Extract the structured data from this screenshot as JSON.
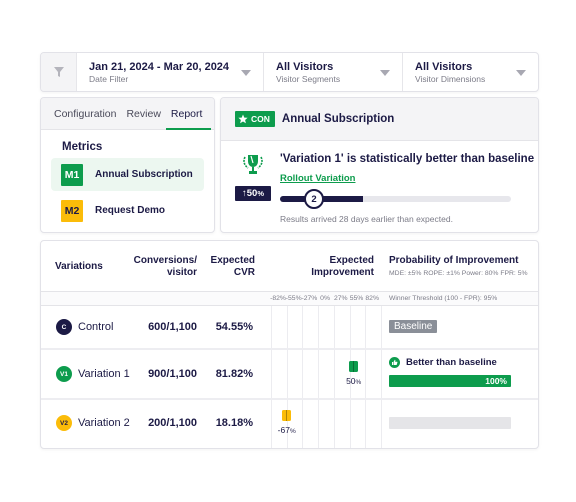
{
  "filter_bar": {
    "icon": "filter-icon",
    "segments": [
      {
        "value": "Jan 21, 2024 - Mar 20, 2024",
        "label": "Date Filter"
      },
      {
        "value": "All Visitors",
        "label": "Visitor Segments"
      },
      {
        "value": "All Visitors",
        "label": "Visitor Dimensions"
      }
    ]
  },
  "left_panel": {
    "tabs": [
      {
        "label": "Configuration",
        "active": false
      },
      {
        "label": "Review",
        "active": false
      },
      {
        "label": "Report",
        "active": true
      }
    ],
    "metrics_title": "Metrics",
    "metrics": [
      {
        "badge": "M1",
        "label": "Annual Subscription",
        "color": "#0d9c4d",
        "text_color": "#ffffff",
        "selected": true
      },
      {
        "badge": "M2",
        "label": "Request Demo",
        "color": "#fbbc09",
        "text_color": "#1c1a45",
        "selected": false
      }
    ]
  },
  "result_panel": {
    "badge": "CON",
    "badge_icon": "star-icon",
    "metric_title": "Annual Subscription",
    "headline": "'Variation 1' is statistically better than baseline",
    "lift": "50",
    "lift_unit": "%",
    "lift_arrow": "↑",
    "rollout_link": "Rollout Variation",
    "progress_step": "2",
    "progress_fraction": 0.36,
    "note": "Results arrived 28 days earlier than expected."
  },
  "table": {
    "headers": {
      "variations": "Variations",
      "conversions_1": "Conversions/",
      "conversions_2": "visitor",
      "cvr_1": "Expected",
      "cvr_2": "CVR",
      "improvement_1": "Expected",
      "improvement_2": "Improvement",
      "probability": "Probability of Improvement",
      "probability_sub": "MDE: ±5%  ROPE: ±1%  Power: 80%  FPR: 5%",
      "winner_threshold": "Winner Threshold (100 - FPR): 95%"
    },
    "axis_ticks": [
      "-82%",
      "-55%",
      "-27%",
      "0%",
      "27%",
      "55%",
      "82%"
    ],
    "axis_values": [
      -82,
      -55,
      -27,
      0,
      27,
      55,
      82
    ],
    "rows": [
      {
        "badge": "C",
        "name": "Control",
        "badge_color": "#1c1a45",
        "badge_text": "#ffffff",
        "conversions": "600/1,100",
        "cvr": "54.55%",
        "improvement": null,
        "improvement_label": "",
        "mark_color": "",
        "status": "Baseline",
        "probability": null,
        "probability_label": ""
      },
      {
        "badge": "V1",
        "name": "Variation 1",
        "badge_color": "#0d9c4d",
        "badge_text": "#ffffff",
        "conversions": "900/1,100",
        "cvr": "81.82%",
        "improvement": 50,
        "improvement_label": "50",
        "mark_color": "#0d9c4d",
        "status": "Better than baseline",
        "probability": 100,
        "probability_label": "100%"
      },
      {
        "badge": "V2",
        "name": "Variation 2",
        "badge_color": "#fbbc09",
        "badge_text": "#1c1a45",
        "conversions": "200/1,100",
        "cvr": "18.18%",
        "improvement": -67,
        "improvement_label": "-67",
        "mark_color": "#fbbc09",
        "status": "",
        "probability": 0,
        "probability_label": ""
      }
    ]
  },
  "colors": {
    "brand_green": "#0d9c4d",
    "navy": "#1c1a45",
    "yellow": "#fbbc09",
    "gray_badge": "#8a8f98"
  }
}
